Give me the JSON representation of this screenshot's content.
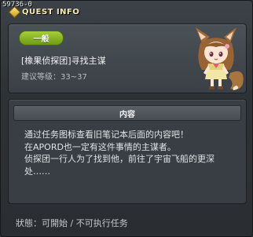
{
  "window": {
    "quest_id": "59736-0",
    "title": "QUEST INFO"
  },
  "summary": {
    "badge": "一般",
    "quest_name": "[橡果侦探团]寻找主谋",
    "level_range": "建议等级：33~37"
  },
  "content": {
    "header": "内容",
    "lines": [
      "通过任务图标查看旧笔记本后面的内容吧！",
      "在APORD也一定有这件事情的主谋者。",
      "侦探团一行人为了找到他，前往了宇宙飞船的更深",
      "处……"
    ]
  },
  "footer": {
    "status": "狀態：可開始 / 不可执行任务"
  },
  "colors": {
    "badge_green": "#8cba27",
    "panel": "#383e43",
    "title_gold": "#f4e9b0"
  },
  "icons": {
    "title_marker": "gold-diamond-icon",
    "npc": "fox-girl-npc-portrait"
  }
}
